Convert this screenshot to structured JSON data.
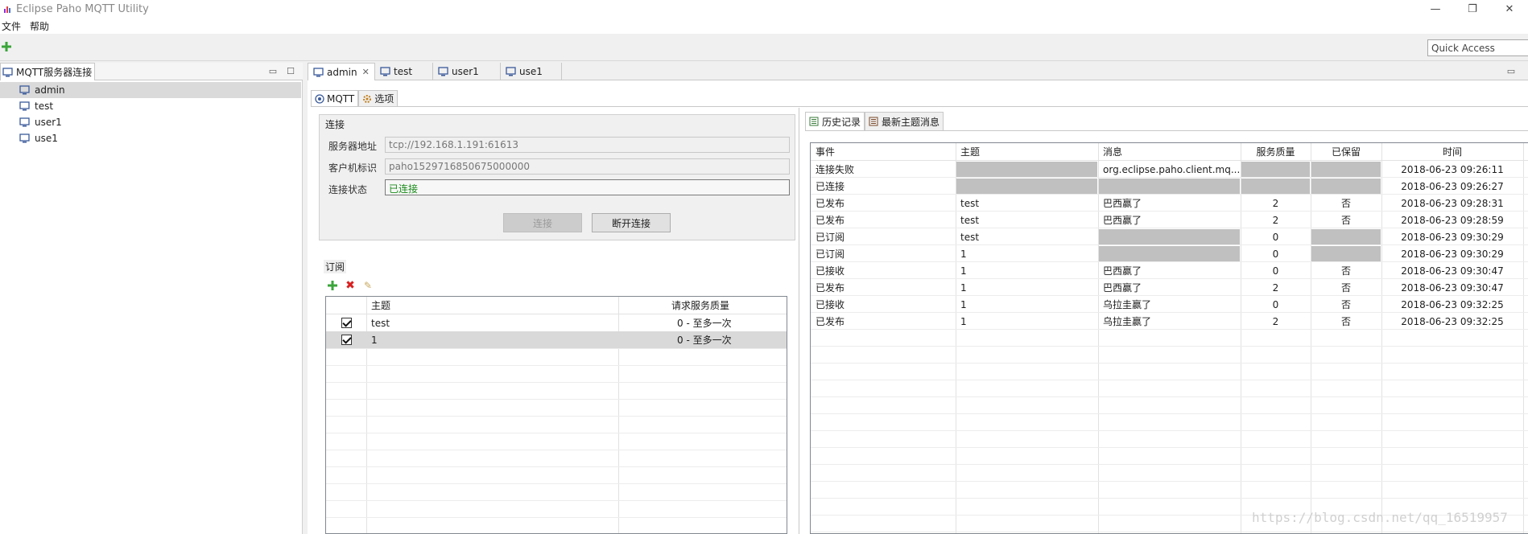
{
  "window": {
    "title": "Eclipse Paho MQTT Utility"
  },
  "menu": [
    "文件",
    "帮助"
  ],
  "quick_access": "Quick Access",
  "left_view": {
    "title": "MQTT服务器连接",
    "items": [
      "admin",
      "test",
      "user1",
      "use1"
    ],
    "selected": "admin"
  },
  "editor_tabs": [
    "admin",
    "test",
    "user1",
    "use1"
  ],
  "inner_tabs": [
    "MQTT",
    "选项"
  ],
  "connection": {
    "group_title": "连接",
    "server_label": "服务器地址",
    "server_value": "tcp://192.168.1.191:61613",
    "client_label": "客户机标识",
    "client_value": "paho1529716850675000000",
    "status_label": "连接状态",
    "status_value": "已连接",
    "connect_button": "连接",
    "disconnect_button": "断开连接"
  },
  "subscription": {
    "group_title": "订阅",
    "headers": [
      "主题",
      "请求服务质量"
    ],
    "rows": [
      {
        "topic": "test",
        "qos": "0 - 至多一次"
      },
      {
        "topic": "1",
        "qos": "0 - 至多一次"
      }
    ]
  },
  "history": {
    "tabs": [
      "历史记录",
      "最新主题消息"
    ],
    "headers": [
      "事件",
      "主题",
      "消息",
      "服务质量",
      "已保留",
      "时间"
    ],
    "rows": [
      {
        "event": "连接失败",
        "topic": "",
        "message": "org.eclipse.paho.client.mq...",
        "qos": "",
        "retained": "",
        "time": "2018-06-23 09:26:11"
      },
      {
        "event": "已连接",
        "topic": "",
        "message": "",
        "qos": "",
        "retained": "",
        "time": "2018-06-23 09:26:27"
      },
      {
        "event": "已发布",
        "topic": "test",
        "message": "巴西赢了",
        "qos": "2",
        "retained": "否",
        "time": "2018-06-23 09:28:31"
      },
      {
        "event": "已发布",
        "topic": "test",
        "message": "巴西赢了",
        "qos": "2",
        "retained": "否",
        "time": "2018-06-23 09:28:59"
      },
      {
        "event": "已订阅",
        "topic": "test",
        "message": "",
        "qos": "0",
        "retained": "",
        "time": "2018-06-23 09:30:29"
      },
      {
        "event": "已订阅",
        "topic": "1",
        "message": "",
        "qos": "0",
        "retained": "",
        "time": "2018-06-23 09:30:29"
      },
      {
        "event": "已接收",
        "topic": "1",
        "message": "巴西赢了",
        "qos": "0",
        "retained": "否",
        "time": "2018-06-23 09:30:47"
      },
      {
        "event": "已发布",
        "topic": "1",
        "message": "巴西赢了",
        "qos": "2",
        "retained": "否",
        "time": "2018-06-23 09:30:47"
      },
      {
        "event": "已接收",
        "topic": "1",
        "message": "乌拉圭赢了",
        "qos": "0",
        "retained": "否",
        "time": "2018-06-23 09:32:25"
      },
      {
        "event": "已发布",
        "topic": "1",
        "message": "乌拉圭赢了",
        "qos": "2",
        "retained": "否",
        "time": "2018-06-23 09:32:25"
      }
    ]
  },
  "watermark": "https://blog.csdn.net/qq_16519957"
}
